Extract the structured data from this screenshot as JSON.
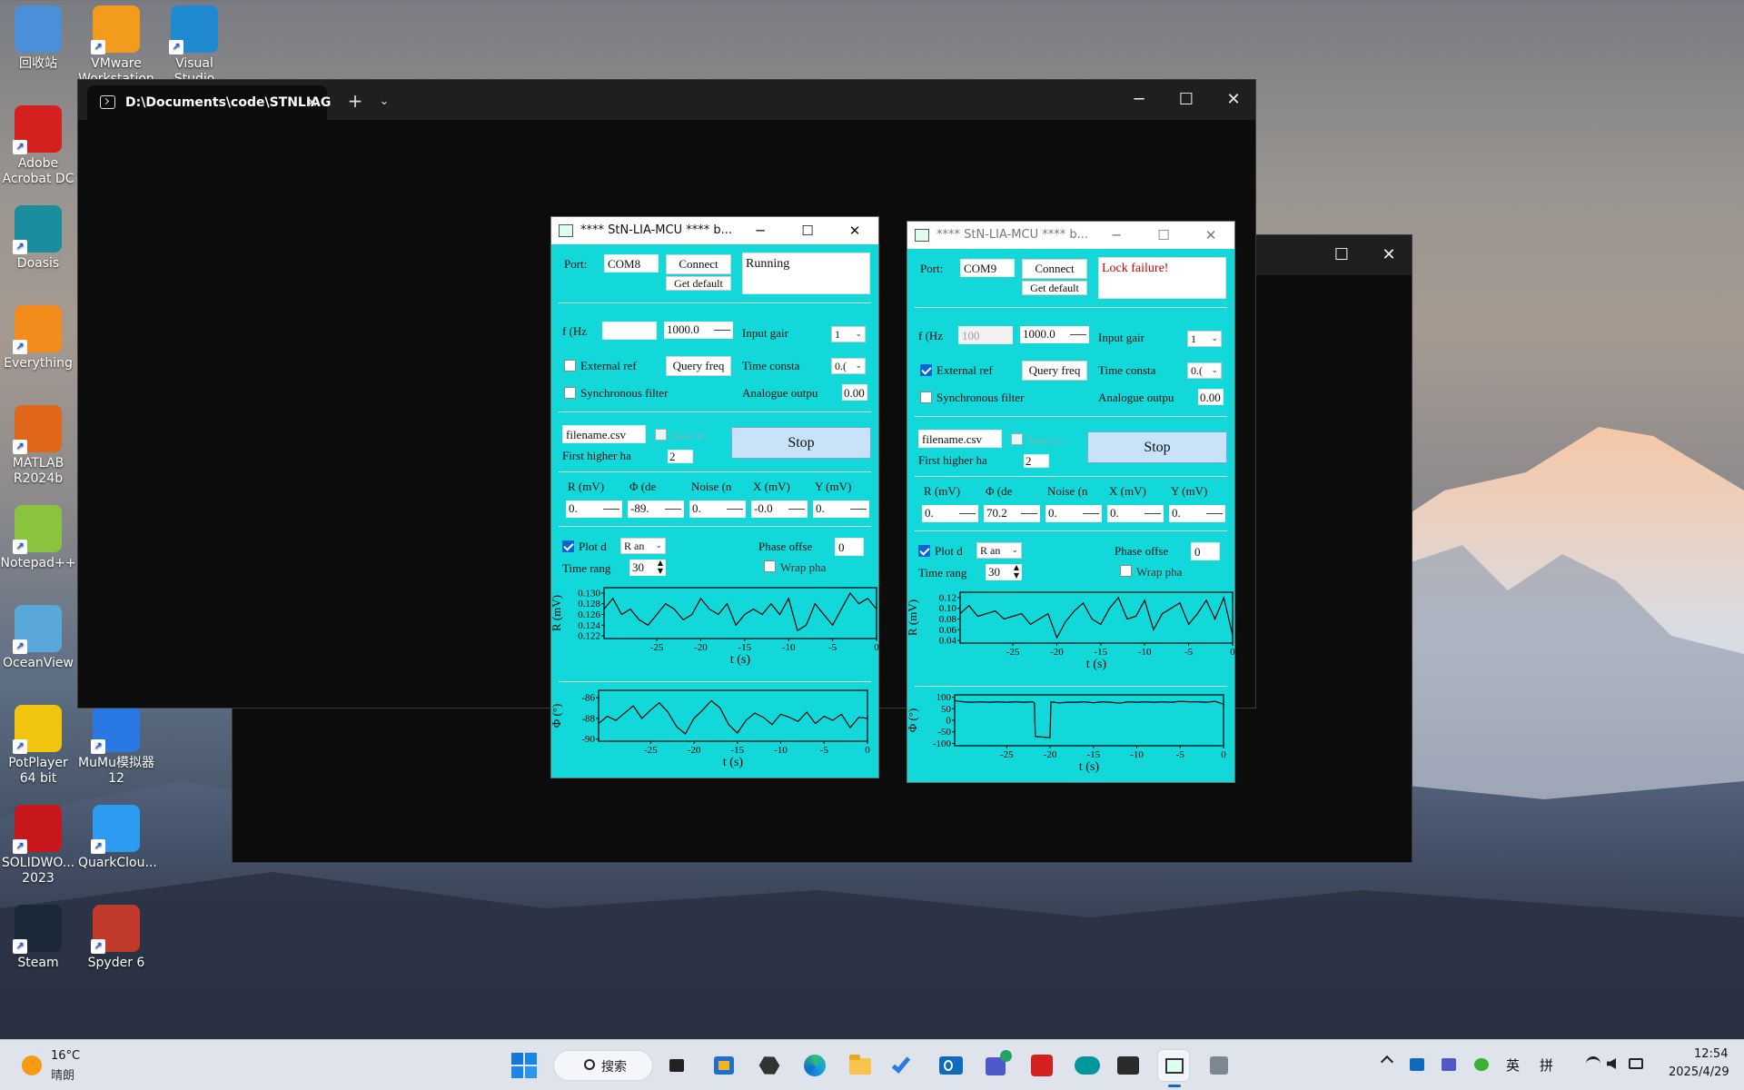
{
  "desktop": {
    "icons": [
      {
        "label": "回收站",
        "icon": "recycle-bin-icon",
        "color": "#4a90d9"
      },
      {
        "label": "VMware Workstation",
        "icon": "vmware-icon",
        "color": "#f29b1d"
      },
      {
        "label": "Visual Studio Code",
        "icon": "vscode-icon",
        "color": "#1f8ad2"
      },
      {
        "label": "Adobe Acrobat DC",
        "icon": "acrobat-icon",
        "color": "#d4201e"
      },
      {
        "label": "Doasis",
        "icon": "doasis-icon",
        "color": "#1a8d9e"
      },
      {
        "label": "Everything",
        "icon": "everything-icon",
        "color": "#f28c1d"
      },
      {
        "label": "MATLAB R2024b",
        "icon": "matlab-icon",
        "color": "#e0661a"
      },
      {
        "label": "Notepad++",
        "icon": "notepadpp-icon",
        "color": "#8ac43f"
      },
      {
        "label": "OceanView",
        "icon": "oceanview-icon",
        "color": "#5aa7d9"
      },
      {
        "label": "PotPlayer 64 bit",
        "icon": "potplayer-icon",
        "color": "#f1c40f"
      },
      {
        "label": "MuMu模拟器12",
        "icon": "mumu-icon",
        "color": "#2a78e4"
      },
      {
        "label": "SOLIDWO... 2023",
        "icon": "solidworks-icon",
        "color": "#c8161d"
      },
      {
        "label": "QuarkClou...",
        "icon": "quarkcloud-icon",
        "color": "#2d9cf0"
      },
      {
        "label": "Steam",
        "icon": "steam-icon",
        "color": "#1b2838"
      },
      {
        "label": "Spyder 6",
        "icon": "spyder-icon",
        "color": "#c0392b"
      }
    ]
  },
  "terminal1": {
    "tab_title": "D:\\Documents\\code\\STNLIAG",
    "tab_close": "✕",
    "new_tab": "+",
    "dropdown": "⌄",
    "minimize": "─",
    "maximize": "☐",
    "close": "✕"
  },
  "terminal2": {
    "minimize": "─",
    "maximize": "☐",
    "close": "✕"
  },
  "app1": {
    "title": "**** StN-LIA-MCU ****    b...",
    "port_label": "Port:",
    "port_value": "COM8",
    "connect": "Connect",
    "get_default": "Get default",
    "status": "Running",
    "status_color": "#111111",
    "f_label": "f (Hz",
    "f_value": "",
    "f_display": "1000.0",
    "input_gain_label": "Input gair",
    "input_gain": "1",
    "ext_ref_label": "External ref",
    "ext_ref_checked": false,
    "query_freq": "Query freq",
    "time_const_label": "Time consta",
    "time_const": "0.(",
    "sync_filter_label": "Synchronous filter",
    "sync_filter_checked": false,
    "analogue_label": "Analogue outpu",
    "analogue_value": "0.00",
    "filename": "filename.csv",
    "save_to": "Save to",
    "stop": "Stop",
    "first_higher_label": "First higher ha",
    "first_higher_value": "2",
    "col_headers": [
      "R (mV)",
      "Φ (de",
      "Noise (n",
      "X (mV)",
      "Y (mV)"
    ],
    "col_values": [
      "0.",
      "-89.",
      "0.",
      "-0.0",
      "0."
    ],
    "plot_label": "Plot d",
    "plot_checked": true,
    "plot_combo": "R an",
    "phase_offset_label": "Phase offse",
    "phase_offset": "0",
    "time_range_label": "Time rang",
    "time_range": "30",
    "wrap_label": "Wrap pha",
    "wrap_checked": false
  },
  "app2": {
    "title": "**** StN-LIA-MCU ****    b...",
    "port_label": "Port:",
    "port_value": "COM9",
    "connect": "Connect",
    "get_default": "Get default",
    "status": "Lock failure!",
    "status_color": "#d40000",
    "f_label": "f (Hz",
    "f_value": "100",
    "f_display": "1000.0",
    "input_gain_label": "Input gair",
    "input_gain": "1",
    "ext_ref_label": "External ref",
    "ext_ref_checked": true,
    "query_freq": "Query freq",
    "time_const_label": "Time consta",
    "time_const": "0.(",
    "sync_filter_label": "Synchronous filter",
    "sync_filter_checked": false,
    "analogue_label": "Analogue outpu",
    "analogue_value": "0.00",
    "filename": "filename.csv",
    "save_to": "Save to",
    "stop": "Stop",
    "first_higher_label": "First higher ha",
    "first_higher_value": "2",
    "col_headers": [
      "R (mV)",
      "Φ (de",
      "Noise (n",
      "X (mV)",
      "Y (mV)"
    ],
    "col_values": [
      "0.",
      "70.2",
      "0.",
      "0.",
      "0."
    ],
    "plot_label": "Plot d",
    "plot_checked": true,
    "plot_combo": "R an",
    "phase_offset_label": "Phase offse",
    "phase_offset": "0",
    "time_range_label": "Time rang",
    "time_range": "30",
    "wrap_label": "Wrap pha",
    "wrap_checked": false
  },
  "chart_data": [
    {
      "type": "line",
      "window": "app1",
      "ylabel": "R (mV)",
      "xlabel": "t (s)",
      "xlim": [
        -31,
        0
      ],
      "ylim": [
        0.1215,
        0.131
      ],
      "xticks": [
        -25,
        -20,
        -15,
        -10,
        -5,
        0
      ],
      "yticks": [
        0.122,
        0.124,
        0.126,
        0.128,
        0.13
      ],
      "yticklabels": [
        "0.122",
        "0.124",
        "0.126",
        "0.128",
        "0.130"
      ],
      "x": [
        -31,
        -30,
        -29,
        -28,
        -27,
        -26,
        -25,
        -24,
        -23,
        -22,
        -21,
        -20,
        -19,
        -18,
        -17,
        -16,
        -15,
        -14,
        -13,
        -12,
        -11,
        -10,
        -9,
        -8,
        -7,
        -6,
        -5,
        -4,
        -3,
        -2,
        -1,
        0
      ],
      "y": [
        0.127,
        0.129,
        0.126,
        0.127,
        0.125,
        0.124,
        0.126,
        0.128,
        0.127,
        0.125,
        0.126,
        0.129,
        0.127,
        0.126,
        0.128,
        0.124,
        0.126,
        0.127,
        0.126,
        0.128,
        0.126,
        0.129,
        0.123,
        0.124,
        0.128,
        0.126,
        0.124,
        0.127,
        0.13,
        0.128,
        0.129,
        0.127
      ]
    },
    {
      "type": "line",
      "window": "app1",
      "ylabel": "Φ (°)",
      "xlabel": "t (s)",
      "xlim": [
        -31,
        0
      ],
      "ylim": [
        -90.2,
        -85.3
      ],
      "xticks": [
        -25,
        -20,
        -15,
        -10,
        -5,
        0
      ],
      "yticks": [
        -90,
        -88,
        -86
      ],
      "yticklabels": [
        "-90",
        "-88",
        "-86"
      ],
      "x": [
        -31,
        -30,
        -29,
        -28,
        -27,
        -26,
        -25,
        -24,
        -23,
        -22,
        -21,
        -20,
        -19,
        -18,
        -17,
        -16,
        -15,
        -14,
        -13,
        -12,
        -11,
        -10,
        -9,
        -8,
        -7,
        -6,
        -5,
        -4,
        -3,
        -2,
        -1,
        0
      ],
      "y": [
        -88.5,
        -87.8,
        -88.2,
        -87.5,
        -86.8,
        -88.0,
        -87.2,
        -86.5,
        -87.4,
        -88.8,
        -89.5,
        -88.0,
        -87.2,
        -86.3,
        -87.0,
        -88.6,
        -89.4,
        -88.2,
        -87.5,
        -87.9,
        -88.6,
        -87.6,
        -87.9,
        -88.3,
        -87.4,
        -88.5,
        -87.8,
        -88.2,
        -87.6,
        -88.9,
        -87.9,
        -88.0
      ]
    },
    {
      "type": "line",
      "window": "app2",
      "ylabel": "R (mV)",
      "xlabel": "t (s)",
      "xlim": [
        -31,
        0
      ],
      "ylim": [
        0.035,
        0.13
      ],
      "xticks": [
        -25,
        -20,
        -15,
        -10,
        -5,
        0
      ],
      "yticks": [
        0.04,
        0.06,
        0.08,
        0.1,
        0.12
      ],
      "yticklabels": [
        "0.04",
        "0.06",
        "0.08",
        "0.10",
        "0.12"
      ],
      "x": [
        -31,
        -30,
        -29,
        -28,
        -27,
        -26,
        -25,
        -24,
        -23,
        -22,
        -21,
        -20,
        -19,
        -18,
        -17,
        -16,
        -15,
        -14,
        -13,
        -12,
        -11,
        -10,
        -9,
        -8,
        -7,
        -6,
        -5,
        -4,
        -3,
        -2,
        -1,
        0
      ],
      "y": [
        0.09,
        0.105,
        0.085,
        0.09,
        0.095,
        0.08,
        0.085,
        0.09,
        0.07,
        0.08,
        0.09,
        0.045,
        0.075,
        0.095,
        0.11,
        0.08,
        0.07,
        0.1,
        0.12,
        0.08,
        0.085,
        0.115,
        0.06,
        0.09,
        0.1,
        0.11,
        0.07,
        0.09,
        0.115,
        0.08,
        0.12,
        0.05
      ]
    },
    {
      "type": "line",
      "window": "app2",
      "ylabel": "Φ (°)",
      "xlabel": "t (s)",
      "xlim": [
        -31,
        0
      ],
      "ylim": [
        -110,
        110
      ],
      "xticks": [
        -25,
        -20,
        -15,
        -10,
        -5,
        0
      ],
      "yticks": [
        -100,
        -50,
        0,
        50,
        100
      ],
      "yticklabels": [
        "-100",
        "-50",
        "0",
        "50",
        "100"
      ],
      "x": [
        -31,
        -30,
        -29,
        -28,
        -27,
        -26,
        -25,
        -24,
        -23,
        -22,
        -21.8,
        -21.7,
        -20,
        -19.9,
        -19,
        -18,
        -17,
        -16,
        -15,
        -14,
        -13,
        -12,
        -11,
        -10,
        -9,
        -8,
        -7,
        -6,
        -5,
        -4,
        -3,
        -2,
        -1,
        0
      ],
      "y": [
        85,
        80,
        78,
        80,
        78,
        80,
        78,
        80,
        78,
        80,
        75,
        -70,
        -75,
        80,
        75,
        78,
        78,
        80,
        76,
        80,
        78,
        74,
        80,
        78,
        80,
        78,
        80,
        78,
        82,
        80,
        80,
        78,
        82,
        70
      ]
    }
  ],
  "taskbar": {
    "weather_temp": "16°C",
    "weather_desc": "晴朗",
    "search": "搜索",
    "ime1": "英",
    "ime2": "拼",
    "time": "12:54",
    "date": "2025/4/29"
  }
}
